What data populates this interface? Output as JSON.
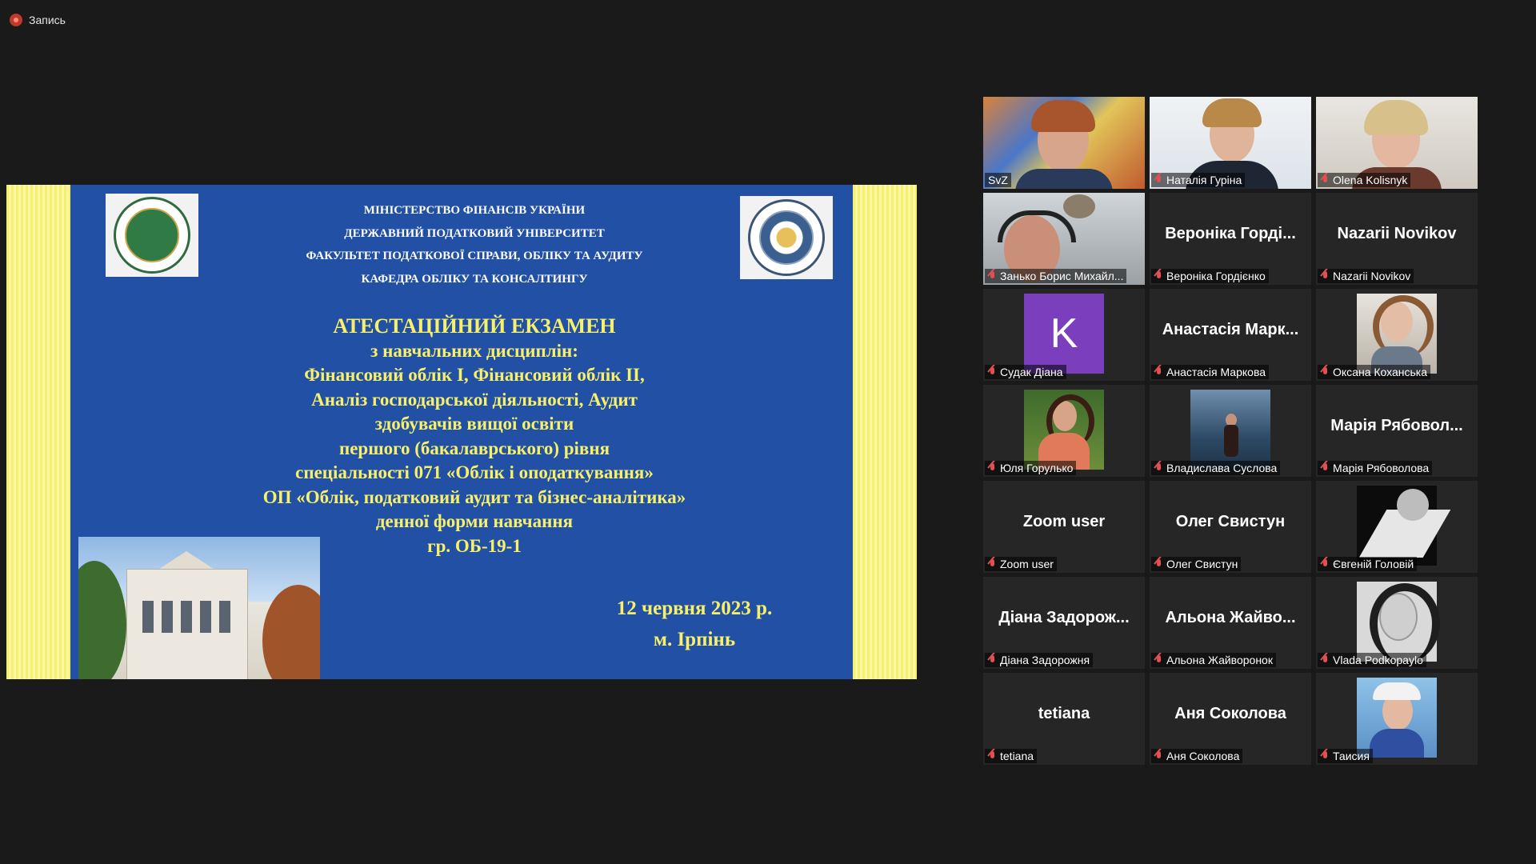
{
  "recording": {
    "label": "Запись"
  },
  "slide": {
    "header_lines": [
      "МІНІСТЕРСТВО ФІНАНСІВ УКРАЇНИ",
      "ДЕРЖАВНИЙ ПОДАТКОВИЙ УНІВЕРСИТЕТ",
      "ФАКУЛЬТЕТ ПОДАТКОВОЇ СПРАВИ, ОБЛІКУ ТА АУДИТУ",
      "КАФЕДРА ОБЛІКУ ТА КОНСАЛТИНГУ"
    ],
    "title_lines": [
      "АТЕСТАЦІЙНИЙ ЕКЗАМЕН",
      "з навчальних дисциплін:",
      "Фінансовий облік І, Фінансовий облік ІІ,",
      "Аналіз господарської діяльності, Аудит",
      "здобувачів вищої освіти",
      "першого (бакалаврського) рівня",
      "спеціальності 071 «Облік і оподаткування»",
      "ОП «Облік, податковий аудит та бізнес-аналітика»",
      "денної форми навчання",
      "гр. ОБ-19-1"
    ],
    "date": "12 червня 2023 р.",
    "city": "м. Ірпінь",
    "colors": {
      "background": "#2250a4",
      "accent": "#f7f06a"
    }
  },
  "participants": [
    {
      "name": "SvZ",
      "display": "video",
      "muted": false,
      "active_speaker": true
    },
    {
      "name": "Наталія Гуріна",
      "display": "video",
      "muted": true
    },
    {
      "name": "Olena Kolisnyk",
      "display": "video",
      "muted": true
    },
    {
      "name": "Занько Борис Михайл...",
      "display": "video",
      "muted": true
    },
    {
      "name": "Вероніка Гордієнко",
      "big_name": "Вероніка Горді...",
      "display": "name",
      "muted": true
    },
    {
      "name": "Nazarii Novikov",
      "big_name": "Nazarii Novikov",
      "display": "name",
      "muted": true
    },
    {
      "name": "Судак Діана",
      "avatar_letter": "K",
      "display": "avatar",
      "muted": true
    },
    {
      "name": "Анастасія Маркова",
      "big_name": "Анастасія Марк...",
      "display": "name",
      "muted": true
    },
    {
      "name": "Оксана Коханська",
      "display": "photo",
      "muted": true
    },
    {
      "name": "Юля Горулько",
      "display": "photo",
      "muted": true
    },
    {
      "name": "Владислава Суслова",
      "display": "photo",
      "muted": true
    },
    {
      "name": "Марія Рябоволова",
      "big_name": "Марія Рябовол...",
      "display": "name",
      "muted": true
    },
    {
      "name": "Zoom user",
      "big_name": "Zoom user",
      "display": "name",
      "muted": true
    },
    {
      "name": "Олег Свистун",
      "big_name": "Олег Свистун",
      "display": "name",
      "muted": true
    },
    {
      "name": "Євгеній Головій",
      "display": "photo",
      "muted": true
    },
    {
      "name": "Діана Задорожня",
      "big_name": "Діана Задорож...",
      "display": "name",
      "muted": true
    },
    {
      "name": "Альона Жайворонок",
      "big_name": "Альона Жайво...",
      "display": "name",
      "muted": true
    },
    {
      "name": "Vlada Podkopaylo",
      "display": "photo",
      "muted": true
    },
    {
      "name": "tetiana",
      "big_name": "tetiana",
      "display": "name",
      "muted": true
    },
    {
      "name": "Аня Соколова",
      "big_name": "Аня Соколова",
      "display": "name",
      "muted": true
    },
    {
      "name": "Таисия",
      "display": "photo",
      "muted": true
    }
  ]
}
